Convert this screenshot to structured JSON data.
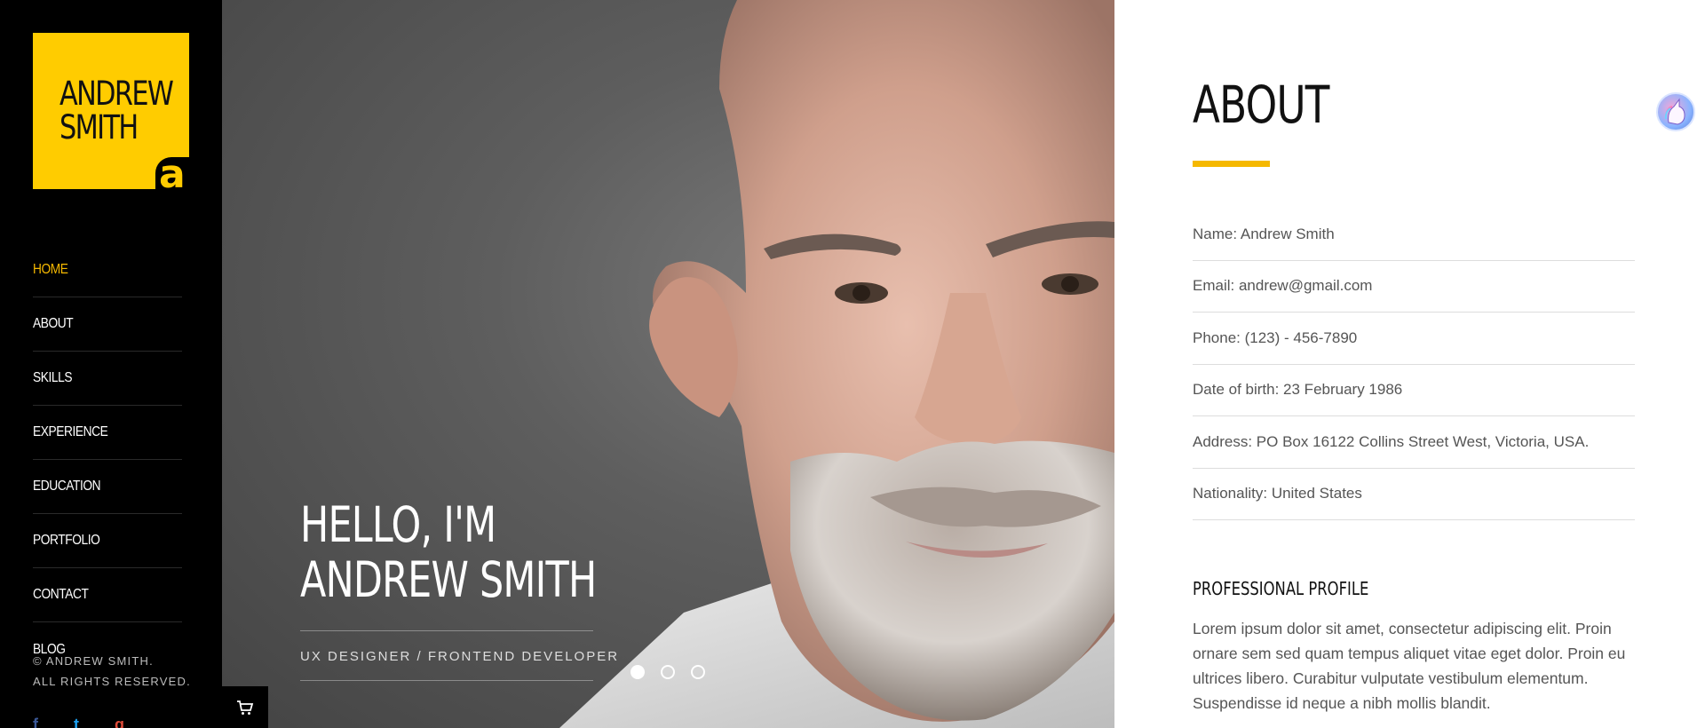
{
  "logo": {
    "name": "ANDREW\nSMITH",
    "mark": "a"
  },
  "nav": {
    "items": [
      {
        "label": "HOME",
        "active": true
      },
      {
        "label": "ABOUT"
      },
      {
        "label": "SKILLS"
      },
      {
        "label": "EXPERIENCE"
      },
      {
        "label": "EDUCATION"
      },
      {
        "label": "PORTFOLIO"
      },
      {
        "label": "CONTACT"
      },
      {
        "label": "BLOG"
      }
    ],
    "active_color": "#f5b800"
  },
  "footer": {
    "copyright_line1": "© ANDREW SMITH.",
    "copyright_line2": "ALL RIGHTS RESERVED.",
    "social": [
      {
        "icon": "facebook-icon",
        "glyph": "f",
        "color": "#3b5998"
      },
      {
        "icon": "twitter-icon",
        "glyph": "t",
        "color": "#1da1f2"
      },
      {
        "icon": "google-plus-icon",
        "glyph": "g",
        "color": "#dd4b39"
      }
    ],
    "cart_icon": "cart-icon"
  },
  "hero": {
    "greeting": "HELLO, I'M",
    "name": "ANDREW SMITH",
    "role": "UX DESIGNER / FRONTEND DEVELOPER",
    "slides": 3,
    "active_slide": 1
  },
  "about": {
    "title": "ABOUT",
    "accent_color": "#f5b800",
    "info": [
      "Name: Andrew Smith",
      "Email: andrew@gmail.com",
      "Phone: (123) - 456-7890",
      "Date of birth: 23 February 1986",
      "Address: PO Box 16122 Collins Street West, Victoria, USA.",
      "Nationality: United States"
    ],
    "profile_title": "PROFESSIONAL PROFILE",
    "profile_text": "Lorem ipsum dolor sit amet, consectetur adipiscing elit. Proin ornare sem sed quam tempus aliquet vitae eget dolor. Proin eu ultrices libero. Curabitur vulputate vestibulum elementum. Suspendisse id neque a nibh mollis blandit."
  }
}
